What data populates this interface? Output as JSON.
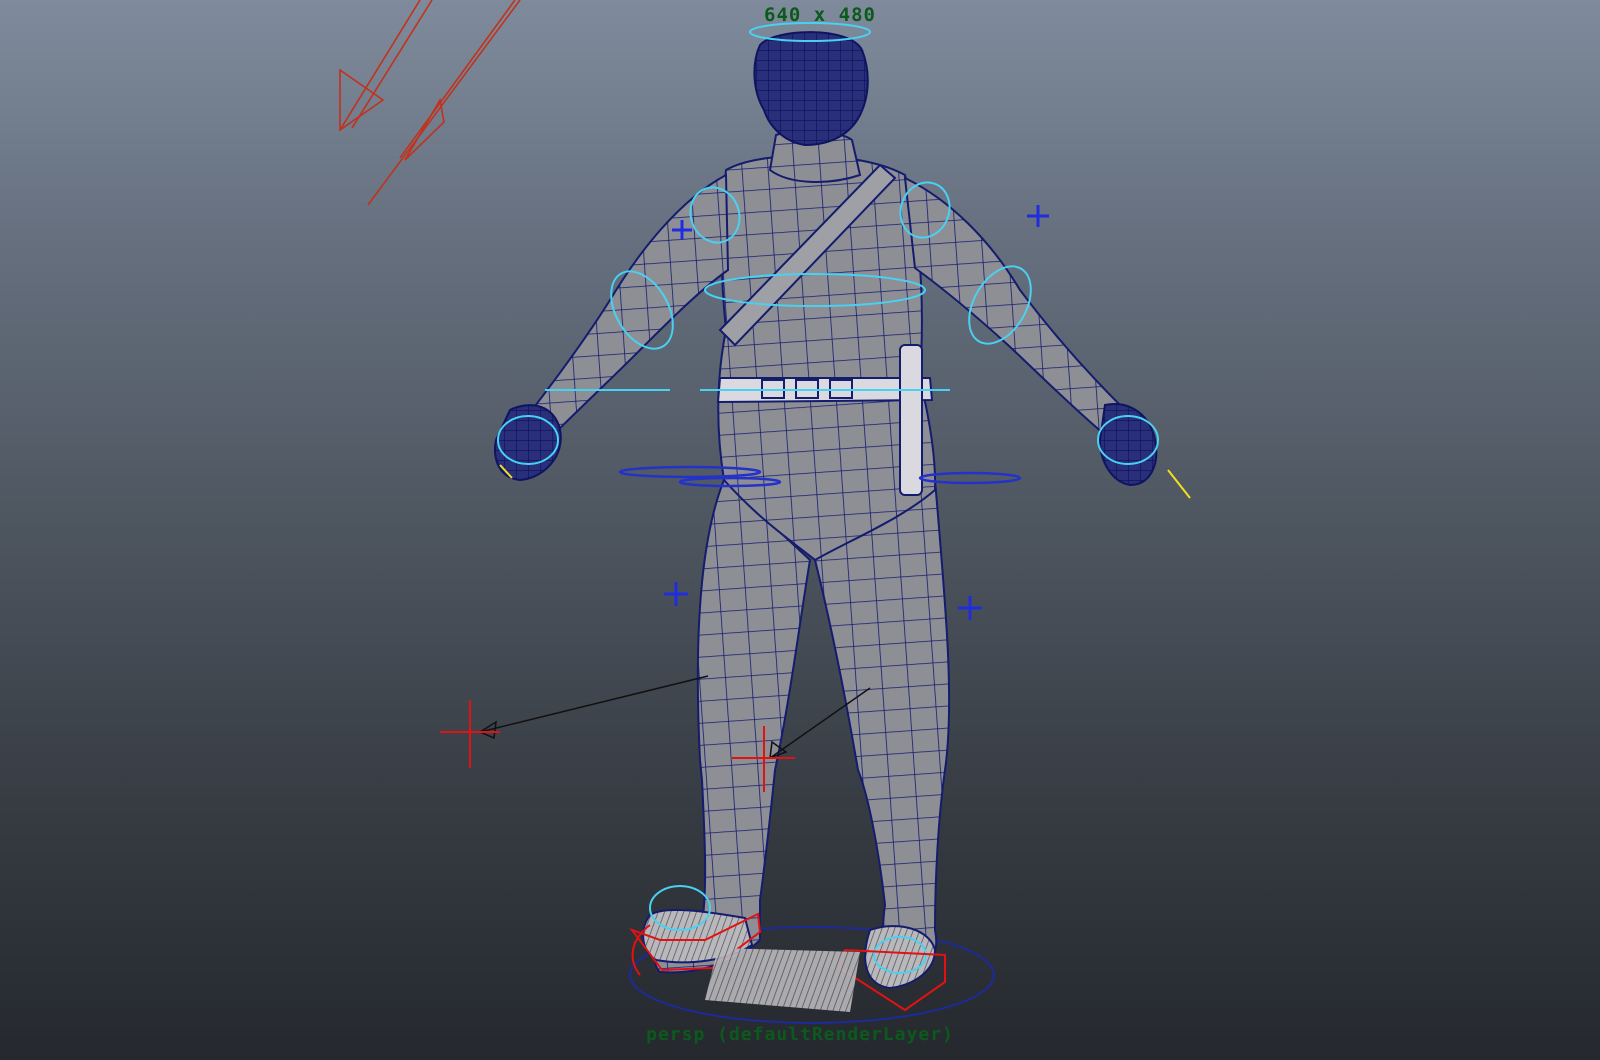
{
  "viewport": {
    "resolution_gate_label": "640 x 480",
    "camera_label": "persp (defaultRenderLayer)"
  },
  "colors": {
    "background_top": "#7f8b9c",
    "background_bottom": "#25292e",
    "mesh_fill": "#8e8e95",
    "wireframe": "#141c6e",
    "control_curve": "#49d1f2",
    "ik_handle": "#e21212",
    "light_gizmo": "#c0321c",
    "locator": "#1f2ce0",
    "label_text": "#0b5a1c"
  }
}
